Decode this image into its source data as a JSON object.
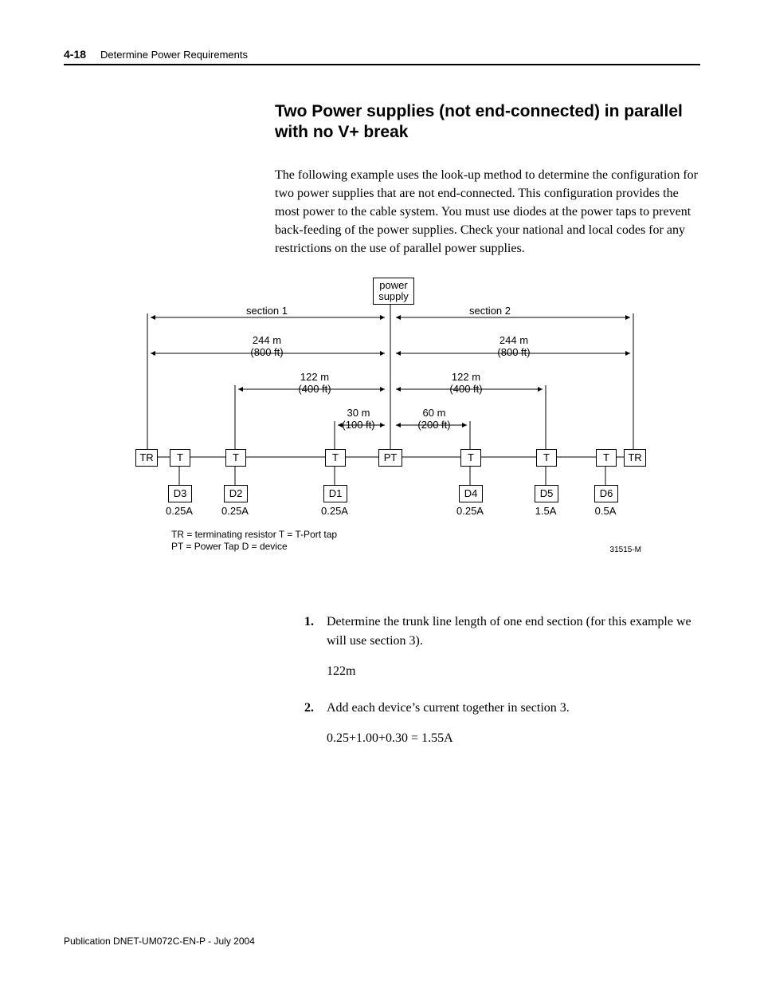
{
  "header": {
    "page_number": "4-18",
    "chapter_title": "Determine Power Requirements"
  },
  "section": {
    "title": "Two Power supplies (not end-connected) in parallel with no V+ break",
    "intro": "The following example uses the look-up method to determine the configuration for two power supplies that are not end-connected. This configuration provides the most power to the cable system. You must use diodes at the power taps to prevent back-feeding of the power supplies. Check your national and local codes for any restrictions on the use of parallel power supplies."
  },
  "diagram": {
    "power_supply": "power\nsupply",
    "section1": "section 1",
    "section2": "section 2",
    "dist_800_m": "244 m",
    "dist_800_ft": "(800 ft)",
    "dist_400_m": "122 m",
    "dist_400_ft": "(400 ft)",
    "dist_100_m": "30 m",
    "dist_100_ft": "(100 ft)",
    "dist_200_m": "60 m",
    "dist_200_ft": "(200 ft)",
    "TR": "TR",
    "T": "T",
    "PT": "PT",
    "D1": "D1",
    "D2": "D2",
    "D3": "D3",
    "D4": "D4",
    "D5": "D5",
    "D6": "D6",
    "c025": "0.25A",
    "c15": "1.5A",
    "c05": "0.5A",
    "legend1": "TR = terminating resistor T = T-Port tap",
    "legend2": "PT = Power Tap D = device",
    "figure_id": "31515-M"
  },
  "steps": {
    "s1_num": "1.",
    "s1_text": "Determine the trunk line length of one end section (for this example we will use section 3).",
    "s1_val": "122m",
    "s2_num": "2.",
    "s2_text": "Add each device’s current together in section 3.",
    "s2_val": "0.25+1.00+0.30 = 1.55A"
  },
  "footer": {
    "pub": "Publication DNET-UM072C-EN-P - July 2004"
  }
}
